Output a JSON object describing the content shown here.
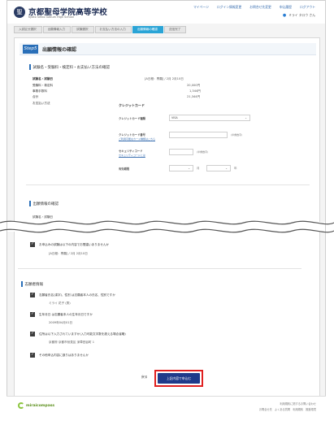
{
  "header": {
    "school_name": "京都聖母学院高等学校",
    "school_en": "Kyoto Seibo Gakuin High School",
    "logo_char": "聖",
    "links": [
      "マイページ",
      "ログイン情報変更",
      "お問合せ先変更",
      "申込履歴",
      "ログアウト"
    ],
    "username": "ミライ タロウ さん"
  },
  "steps": [
    "入試区分選択",
    "出願情報入力",
    "試験選択",
    "お支払い方法の入力",
    "出願情報の確認",
    "送信完了"
  ],
  "page": {
    "step_badge": "Step5",
    "step_heading": "出願情報の確認"
  },
  "payment_section": {
    "title": "試験名・受験料・検定料・お支払い方法の確認",
    "exam_label": "試験名・試験日",
    "exam_value": "[A日程：専願] / 2月 2月10日",
    "fee_label": "受験料・検定料",
    "fee_value": "20,000円",
    "handling_label": "事務手数料",
    "handling_value": "1,344円",
    "total_label": "合計",
    "total_value": "21,344円",
    "method_label": "お支払い方法"
  },
  "credit_form": {
    "heading": "クレジットカード",
    "card_type_label": "クレジットカード種類",
    "card_type_value": "VISA",
    "card_number_label": "クレジットカード番号",
    "card_number_link": "ご利用可能なカード種類はこちら",
    "card_number_hint": "(半角数字)",
    "cvv_label": "セキュリティコード",
    "cvv_link": "セキュリティコードとは",
    "cvv_hint": "(半角数字)",
    "expiry_label": "有効期限",
    "month_suffix": "月",
    "year_suffix": "年"
  },
  "confirm_section": {
    "title": "出願情報の確認",
    "cut_label_1": "試験名・試験日",
    "cut_label_2": "試験名・試験日"
  },
  "checks_top": {
    "q1": "お申込みの試験は以下の内容でお間違いありませんか",
    "a1": "[A日程：専願] / 2月 2月10日"
  },
  "applicant_section": {
    "title": "志願者情報",
    "q1": "志願者氏名(漢字)、性別 は志願者本人の氏名、性別ですか",
    "a1": "ミライ 花子 (男)",
    "q2": "生年月日 は志願者本人の生年月日ですか",
    "a2": "2009年04月01日",
    "q3": "住所は以下入力されていますか(入力可能文字数を超える場合省略)",
    "a3": "京都府 京都市伏見区 深草田谷町 1",
    "q4": "その他申込内容に誤りはありませんか"
  },
  "actions": {
    "back_label": "戻る",
    "confirm_label": "上記内容で申込む"
  },
  "footer": {
    "brand": "miraicompass",
    "links": [
      "利用規約に関するお問い合わせ",
      "お問合せ先　よくある質問　利用規約　推奨環境"
    ]
  }
}
